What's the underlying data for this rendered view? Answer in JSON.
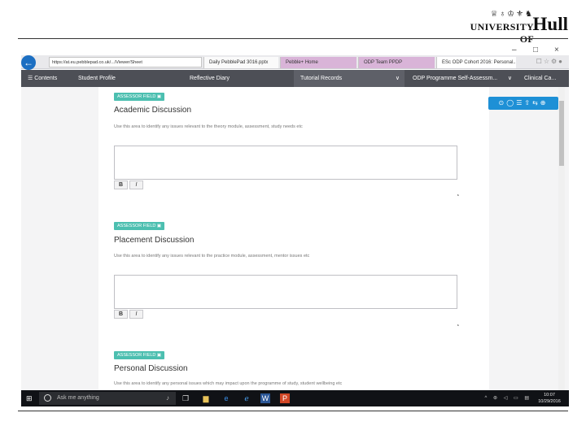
{
  "logo": {
    "university_text": "UNIVERSITY OF",
    "hull_text": "Hull"
  },
  "window": {
    "minimize": "–",
    "maximize": "□",
    "close": "×"
  },
  "browser": {
    "address": "https://at.eu.pebblepad.co.uk/.../Viewer/Sheet",
    "tabs": [
      {
        "label": "Daily PebblePad 3016.pptx"
      },
      {
        "label": "Pebble+ Home"
      },
      {
        "label": "ODP Team PPDP"
      },
      {
        "label": "ESc ODP Cohort 2016: Personal..."
      }
    ]
  },
  "nav": {
    "items": [
      {
        "label": "Contents"
      },
      {
        "label": "Student Profile"
      },
      {
        "label": "Reflective Diary"
      },
      {
        "label": "Tutorial Records"
      },
      {
        "label": "ODP Programme Self-Assessm..."
      },
      {
        "label": "Clinical Ca..."
      }
    ]
  },
  "sections": [
    {
      "badge": "ASSESSOR FIELD",
      "title": "Academic Discussion",
      "description": "Use this area to identify any issues relevant to the theory module, assessment, study needs etc"
    },
    {
      "badge": "ASSESSOR FIELD",
      "title": "Placement Discussion",
      "description": "Use this area to identify any issues relevant to the practice module, assessment, mentor issues etc"
    },
    {
      "badge": "ASSESSOR FIELD",
      "title": "Personal Discussion",
      "description": "Use this area to identify any personal issues which may impact upon the programme of study, student wellbeing etc"
    }
  ],
  "format": {
    "bold": "B",
    "italic": "I"
  },
  "taskbar": {
    "search_placeholder": "Ask me anything",
    "time": "10:07",
    "date": "10/29/2016"
  },
  "colors": {
    "nav_bg": "#4d4f56",
    "badge": "#4cbfb0",
    "toolbox": "#1e90d6",
    "back_button": "#1c6fc2",
    "taskbar": "#101216"
  }
}
